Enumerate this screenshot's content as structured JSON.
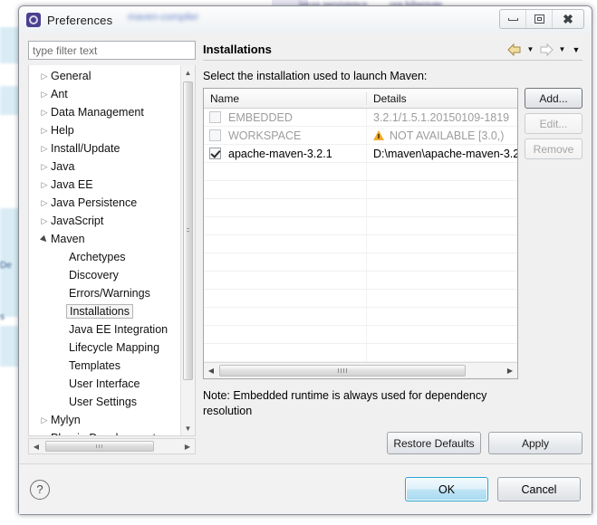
{
  "background": {
    "blur_lines": [
      "javax.persistence",
      "org.hibernate",
      "maven-compiler"
    ],
    "left_labels": [
      "De",
      "s"
    ]
  },
  "window": {
    "title": "Preferences",
    "icon": "preferences-icon",
    "controls": {
      "minimize": "minimize-icon",
      "maximize": "maximize-icon",
      "close": "close-icon"
    }
  },
  "filter": {
    "placeholder": "type filter text",
    "value": ""
  },
  "tree": {
    "items": [
      {
        "label": "General",
        "level": 0,
        "expandable": true,
        "expanded": false,
        "selected": false
      },
      {
        "label": "Ant",
        "level": 0,
        "expandable": true,
        "expanded": false,
        "selected": false
      },
      {
        "label": "Data Management",
        "level": 0,
        "expandable": true,
        "expanded": false,
        "selected": false
      },
      {
        "label": "Help",
        "level": 0,
        "expandable": true,
        "expanded": false,
        "selected": false
      },
      {
        "label": "Install/Update",
        "level": 0,
        "expandable": true,
        "expanded": false,
        "selected": false
      },
      {
        "label": "Java",
        "level": 0,
        "expandable": true,
        "expanded": false,
        "selected": false
      },
      {
        "label": "Java EE",
        "level": 0,
        "expandable": true,
        "expanded": false,
        "selected": false
      },
      {
        "label": "Java Persistence",
        "level": 0,
        "expandable": true,
        "expanded": false,
        "selected": false
      },
      {
        "label": "JavaScript",
        "level": 0,
        "expandable": true,
        "expanded": false,
        "selected": false
      },
      {
        "label": "Maven",
        "level": 0,
        "expandable": true,
        "expanded": true,
        "selected": false
      },
      {
        "label": "Archetypes",
        "level": 1,
        "expandable": false,
        "expanded": false,
        "selected": false
      },
      {
        "label": "Discovery",
        "level": 1,
        "expandable": false,
        "expanded": false,
        "selected": false
      },
      {
        "label": "Errors/Warnings",
        "level": 1,
        "expandable": false,
        "expanded": false,
        "selected": false
      },
      {
        "label": "Installations",
        "level": 1,
        "expandable": false,
        "expanded": false,
        "selected": true
      },
      {
        "label": "Java EE Integration",
        "level": 1,
        "expandable": false,
        "expanded": false,
        "selected": false
      },
      {
        "label": "Lifecycle Mapping",
        "level": 1,
        "expandable": false,
        "expanded": false,
        "selected": false
      },
      {
        "label": "Templates",
        "level": 1,
        "expandable": false,
        "expanded": false,
        "selected": false
      },
      {
        "label": "User Interface",
        "level": 1,
        "expandable": false,
        "expanded": false,
        "selected": false
      },
      {
        "label": "User Settings",
        "level": 1,
        "expandable": false,
        "expanded": false,
        "selected": false
      },
      {
        "label": "Mylyn",
        "level": 0,
        "expandable": true,
        "expanded": false,
        "selected": false
      },
      {
        "label": "Plug-in Development",
        "level": 0,
        "expandable": true,
        "expanded": false,
        "selected": false
      }
    ],
    "scroll_up_icon": "scroll-up-icon",
    "scroll_down_icon": "scroll-down-icon",
    "scroll_left_icon": "scroll-left-icon",
    "scroll_right_icon": "scroll-right-icon"
  },
  "panel": {
    "title": "Installations",
    "subtitle": "Select the installation used to launch Maven:",
    "nav": {
      "back_icon": "back-arrow-icon",
      "back_menu_icon": "chevron-down-icon",
      "forward_icon": "forward-arrow-icon",
      "forward_menu_icon": "chevron-down-icon",
      "view_menu_icon": "view-menu-icon"
    },
    "table": {
      "columns": [
        "Name",
        "Details"
      ],
      "rows": [
        {
          "checked": false,
          "enabled": false,
          "name": "EMBEDDED",
          "details": "3.2.1/1.5.1.20150109-1819",
          "warning": false
        },
        {
          "checked": false,
          "enabled": false,
          "name": "WORKSPACE",
          "details": "NOT AVAILABLE [3.0,)",
          "warning": true
        },
        {
          "checked": true,
          "enabled": true,
          "name": "apache-maven-3.2.1",
          "details": "D:\\maven\\apache-maven-3.2",
          "warning": false
        }
      ]
    },
    "buttons": {
      "add": "Add...",
      "edit": "Edit...",
      "remove": "Remove"
    },
    "note": "Note: Embedded runtime is always used for dependency resolution",
    "restore_defaults": "Restore Defaults",
    "apply": "Apply"
  },
  "footer": {
    "help_icon": "help-icon",
    "help_glyph": "?",
    "ok": "OK",
    "cancel": "Cancel"
  },
  "colors": {
    "accent": "#2aa3cf",
    "warning": "#f0ab2e",
    "disabled_text": "#9d9d9d"
  }
}
